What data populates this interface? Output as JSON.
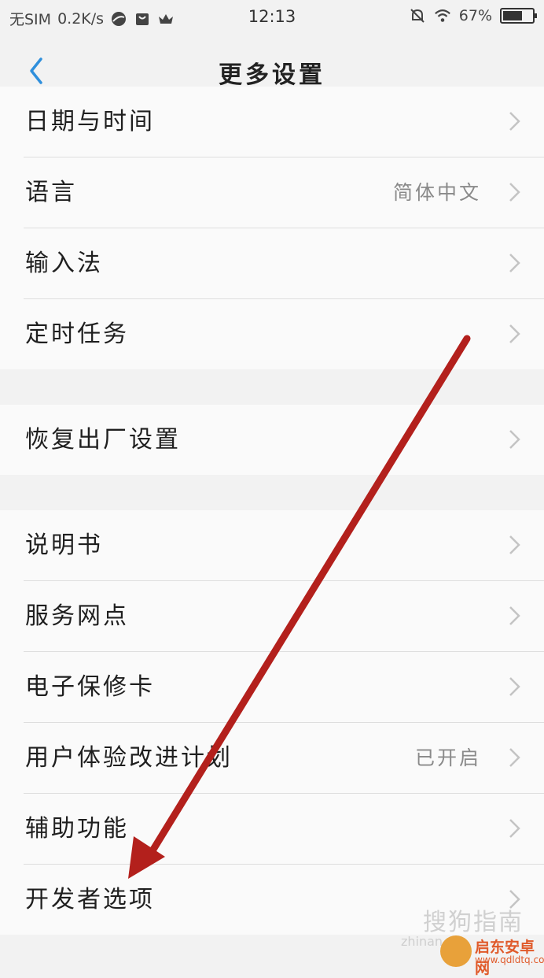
{
  "status": {
    "carrier": "无SIM",
    "speed": "0.2K/s",
    "time": "12:13",
    "battery": "67%",
    "battery_level": 0.67
  },
  "header": {
    "title": "更多设置"
  },
  "groups": [
    {
      "items": [
        {
          "label": "日期与时间",
          "value": ""
        },
        {
          "label": "语言",
          "value": "简体中文"
        },
        {
          "label": "输入法",
          "value": ""
        },
        {
          "label": "定时任务",
          "value": ""
        }
      ]
    },
    {
      "items": [
        {
          "label": "恢复出厂设置",
          "value": ""
        }
      ]
    },
    {
      "items": [
        {
          "label": "说明书",
          "value": ""
        },
        {
          "label": "服务网点",
          "value": ""
        },
        {
          "label": "电子保修卡",
          "value": ""
        },
        {
          "label": "用户体验改进计划",
          "value": "已开启"
        },
        {
          "label": "辅助功能",
          "value": ""
        },
        {
          "label": "开发者选项",
          "value": ""
        }
      ]
    }
  ],
  "annotation": {
    "arrow_color": "#b3201c"
  },
  "watermark": {
    "text1": "搜狗指南",
    "text2": "zhinan",
    "logo_text": "启东安卓网",
    "logo_url": "www.qdldtq.com"
  }
}
